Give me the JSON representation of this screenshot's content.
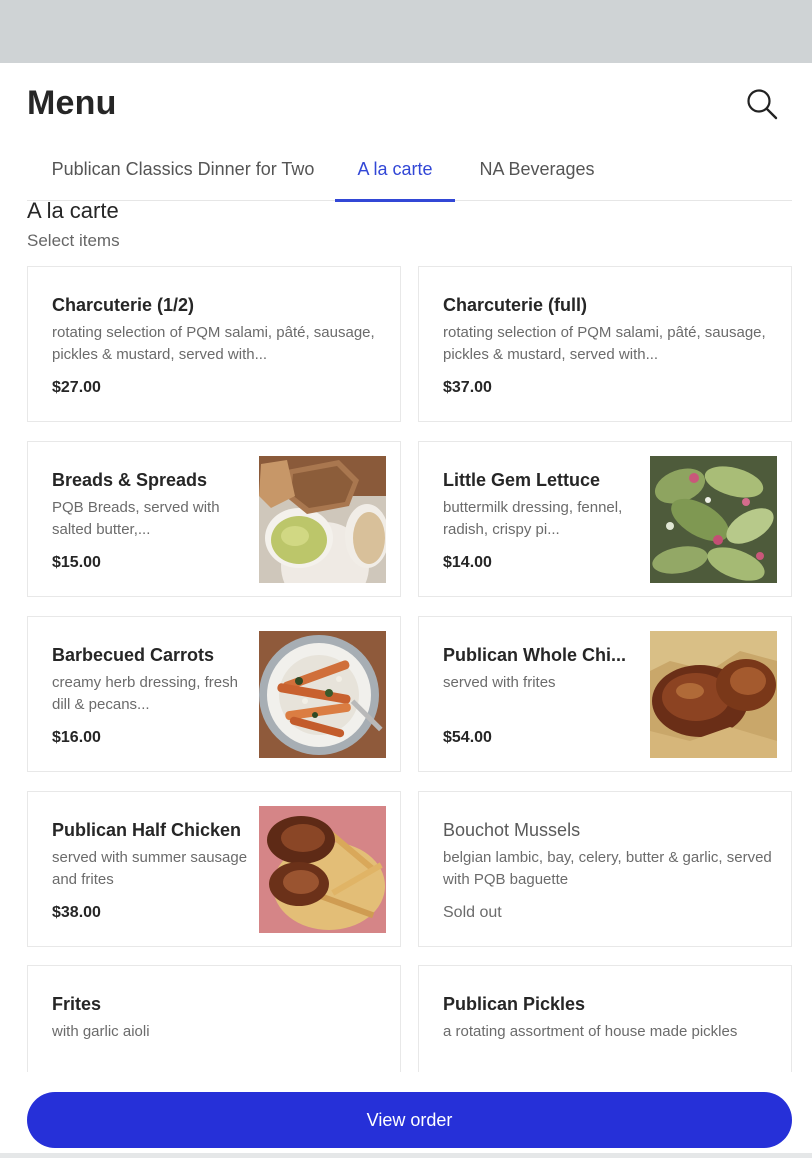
{
  "header": {
    "title": "Menu",
    "search_icon": "search-icon"
  },
  "tabs": [
    {
      "label": "Publican Classics Dinner for Two",
      "active": false
    },
    {
      "label": "A la carte",
      "active": true
    },
    {
      "label": "NA Beverages",
      "active": false
    }
  ],
  "section": {
    "title": "A la carte",
    "subtitle": "Select items"
  },
  "items": [
    {
      "name": "Charcuterie (1/2)",
      "description": "rotating selection of PQM salami, pâté, sausage, pickles & mustard, served with...",
      "price": "$27.00",
      "image": false
    },
    {
      "name": "Charcuterie (full)",
      "description": "rotating selection of PQM salami, pâté, sausage, pickles & mustard, served with...",
      "price": "$37.00",
      "image": false
    },
    {
      "name": "Breads & Spreads",
      "description": "PQB Breads, served with salted butter,...",
      "price": "$15.00",
      "image": true
    },
    {
      "name": "Little Gem Lettuce",
      "description": "buttermilk dressing, fennel, radish, crispy pi...",
      "price": "$14.00",
      "image": true
    },
    {
      "name": "Barbecued Carrots",
      "description": "creamy herb dressing, fresh dill & pecans...",
      "price": "$16.00",
      "image": true
    },
    {
      "name": "Publican Whole Chi...",
      "description": "served with frites",
      "price": "$54.00",
      "image": true
    },
    {
      "name": "Publican Half Chicken",
      "description": "served with summer sausage and frites",
      "price": "$38.00",
      "image": true
    },
    {
      "name": "Bouchot Mussels",
      "description": "belgian lambic, bay, celery, butter & garlic, served with PQB baguette",
      "price": "Sold out",
      "image": false
    },
    {
      "name": "Frites",
      "description": "with garlic aioli",
      "price": "",
      "image": false
    },
    {
      "name": "Publican Pickles",
      "description": "a rotating assortment of house made pickles",
      "price": "",
      "image": false
    }
  ],
  "footer": {
    "view_order_label": "View order"
  },
  "colors": {
    "accent": "#3247d6",
    "button": "#2630d8",
    "topbar": "#cfd3d5"
  }
}
